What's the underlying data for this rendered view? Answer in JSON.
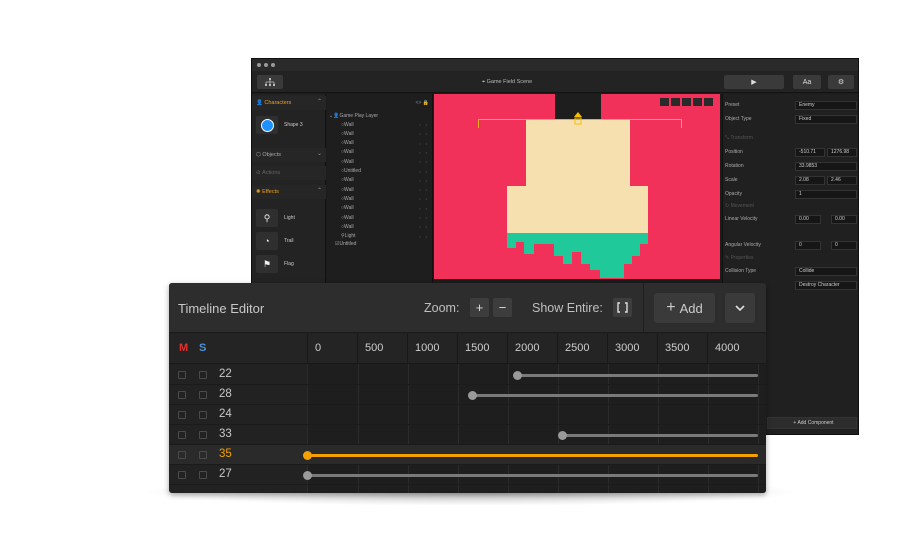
{
  "editor": {
    "scene_title": "Game Field Scene",
    "play_icon": "play-icon",
    "font_button": "Aa",
    "settings_icon": "gear-icon",
    "library": {
      "sections": [
        {
          "label": "Characters",
          "color": "#f0a020"
        },
        {
          "label": "Objects",
          "color": "#aaaaaa"
        },
        {
          "label": "Actions",
          "color": "#666666"
        },
        {
          "label": "Effects",
          "color": "#f0a020"
        }
      ],
      "character_item": "Shape 3",
      "effects": [
        "Light",
        "Trail",
        "Flag"
      ]
    },
    "hierarchy": {
      "layer": "Game Play Layer",
      "items": [
        "Wall",
        "Wall",
        "Wall",
        "Wall",
        "Wall",
        "Untitled",
        "Wall",
        "Wall",
        "Wall",
        "Wall",
        "Wall",
        "Wall",
        "Light"
      ],
      "bottom": "Untitled"
    },
    "inspector": {
      "preset_label": "Preset",
      "preset_value": "Enemy",
      "object_type_label": "Object Type",
      "object_type_value": "Fixed",
      "transform_header": "Transform",
      "position_label": "Position",
      "position_x": "-510.71",
      "position_y": "1276.98",
      "rotation_label": "Rotation",
      "rotation_value": "33.9853",
      "scale_label": "Scale",
      "scale_x": "2.08",
      "scale_y": "2.46",
      "opacity_label": "Opacity",
      "opacity_value": "1",
      "movement_header": "Movement",
      "linear_velocity_label": "Linear Velocity",
      "linear_x": "0.00",
      "linear_y": "0.00",
      "angular_velocity_label": "Angular Velocity",
      "angular_value": "0",
      "angular_value2": "0",
      "properties_header": "Properties",
      "collision_label": "Collision Type",
      "collision_value": "Collide",
      "destroy_value": "Destroy Character",
      "add_component": "+ Add Component"
    },
    "colors": {
      "canvas": "#f2315a",
      "platform": "#f7e0b0",
      "grass": "#1fc99a",
      "accent": "#f5a623"
    }
  },
  "timeline": {
    "title": "Timeline Editor",
    "zoom_label": "Zoom:",
    "zoom_in": "+",
    "zoom_out": "−",
    "show_entire_label": "Show Entire:",
    "show_entire_icon": "fit-icon",
    "add_label": "Add",
    "add_icon": "plus-icon",
    "dropdown_icon": "chevron-down-icon",
    "m_label": "M",
    "s_label": "S",
    "ruler": [
      "0",
      "500",
      "1000",
      "1500",
      "2000",
      "2500",
      "3000",
      "3500",
      "4000"
    ],
    "rows": [
      {
        "id": "22",
        "start": 2100,
        "selected": false
      },
      {
        "id": "28",
        "start": 1650,
        "selected": false
      },
      {
        "id": "24",
        "start": null,
        "selected": false
      },
      {
        "id": "33",
        "start": 2550,
        "selected": false
      },
      {
        "id": "35",
        "start": 0,
        "selected": true
      },
      {
        "id": "27",
        "start": 0,
        "selected": false
      }
    ],
    "colors": {
      "m": "#e03030",
      "s": "#4a90d9",
      "active": "#f5a000",
      "track": "#7a7a7a",
      "knob": "#9a9a9a"
    }
  }
}
